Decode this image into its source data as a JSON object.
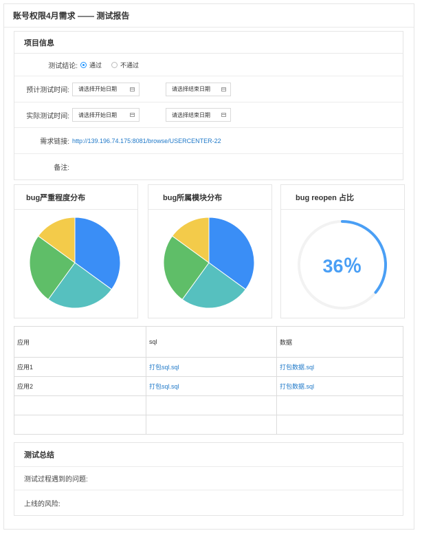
{
  "page": {
    "title": "账号权限4月需求 —— 测试报告"
  },
  "project": {
    "heading": "项目信息",
    "conclusion_label": "测试结论:",
    "options": [
      {
        "label": "通过",
        "checked": true
      },
      {
        "label": "不通过",
        "checked": false
      }
    ],
    "planned_label": "预计测试时间:",
    "actual_label": "实际测试时间:",
    "start_placeholder": "请选择开始日期",
    "end_placeholder": "请选择结束日期",
    "link_label": "需求链接:",
    "link_url": "http://139.196.74.175:8081/browse/USERCENTER-22",
    "remark_label": "备注:"
  },
  "charts": {
    "severity_title": "bug严重程度分布",
    "module_title": "bug所属模块分布",
    "reopen_title": "bug  reopen 占比",
    "reopen_text": "36％"
  },
  "chart_data": [
    {
      "type": "pie",
      "values": [
        35,
        25,
        25,
        15
      ],
      "colors": [
        "#3a8ef6",
        "#56c0bf",
        "#5fbe68",
        "#f3cb4a"
      ]
    },
    {
      "type": "pie",
      "values": [
        35,
        25,
        25,
        15
      ],
      "colors": [
        "#3a8ef6",
        "#56c0bf",
        "#5fbe68",
        "#f3cb4a"
      ]
    },
    {
      "type": "gauge",
      "value": 36,
      "unit": "%",
      "color": "#4a9ff5",
      "track_color": "#f2f2f2"
    }
  ],
  "table": {
    "headers": [
      "应用",
      "sql",
      "数据"
    ],
    "rows": [
      [
        "应用1",
        "打包sql.sql",
        "打包数据.sql"
      ],
      [
        "应用2",
        "打包sql.sql",
        "打包数据.sql"
      ],
      [
        "",
        "",
        ""
      ],
      [
        "",
        "",
        ""
      ]
    ]
  },
  "summary": {
    "heading": "测试总结",
    "problems_label": "测试过程遇到的问题:",
    "risk_label": "上线的风险:"
  }
}
